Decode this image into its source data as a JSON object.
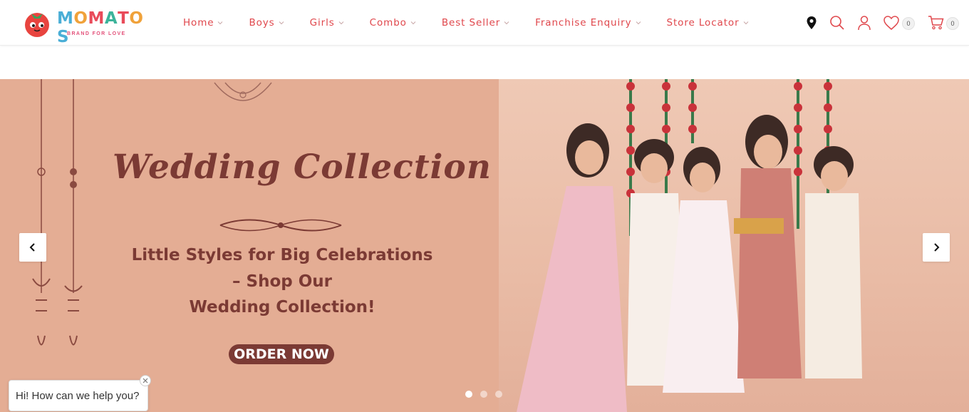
{
  "brand": {
    "name_letters": [
      "M",
      "O",
      "M",
      "A",
      "T",
      "O",
      "S"
    ],
    "letter_colors": [
      "#4aaed6",
      "#f0a23a",
      "#e94b5a",
      "#3cb39a",
      "#e94b5a",
      "#f0a23a",
      "#4aaed6"
    ],
    "tagline": "BRAND FOR LOVE",
    "accent": "#e0474c"
  },
  "nav": {
    "items": [
      {
        "label": "Home"
      },
      {
        "label": "Boys"
      },
      {
        "label": "Girls"
      },
      {
        "label": "Combo"
      },
      {
        "label": "Best Seller"
      },
      {
        "label": "Franchise Enquiry"
      },
      {
        "label": "Store Locator"
      }
    ]
  },
  "header_icons": {
    "icons": [
      "map-pin-icon",
      "search-icon",
      "user-icon",
      "heart-icon",
      "cart-icon"
    ],
    "wishlist_count": "0",
    "cart_count": "0"
  },
  "banner": {
    "title": "Wedding Collection",
    "subtitle_lines": [
      "Little Styles for Big Celebrations",
      "– Shop Our",
      "Wedding Collection!"
    ],
    "cta_label": "ORDER NOW",
    "background_color": "#e4ad94",
    "text_color": "#7b3a34",
    "slides_count": 3,
    "active_slide": 1
  },
  "chat": {
    "greeting": "Hi! How can we help you?"
  }
}
